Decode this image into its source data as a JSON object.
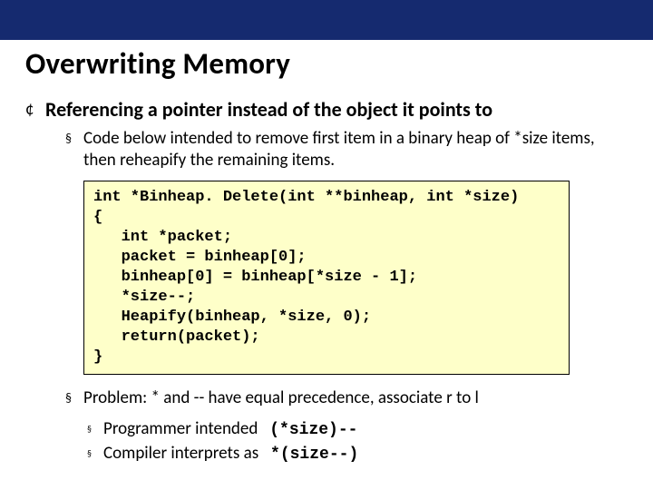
{
  "topbar": {},
  "title": "Overwriting Memory",
  "bullets": {
    "level1": {
      "mark": "¢",
      "text": "Referencing a pointer instead of the object it points to"
    },
    "level2_top": {
      "mark": "§",
      "text": "Code below intended to remove first item in a binary heap of *size items, then reheapify the remaining items."
    },
    "level2_bottom": {
      "mark": "§",
      "text": "Problem: * and -- have equal precedence, associate r to l"
    },
    "level3_a": {
      "mark": "§",
      "text_pre": "Programmer intended",
      "code": "(*size)--"
    },
    "level3_b": {
      "mark": "§",
      "text_pre": "Compiler interprets as",
      "code": "*(size--)"
    }
  },
  "code": "int *Binheap. Delete(int **binheap, int *size)\n{\n   int *packet;\n   packet = binheap[0];\n   binheap[0] = binheap[*size - 1];\n   *size--;\n   Heapify(binheap, *size, 0);\n   return(packet);\n}"
}
